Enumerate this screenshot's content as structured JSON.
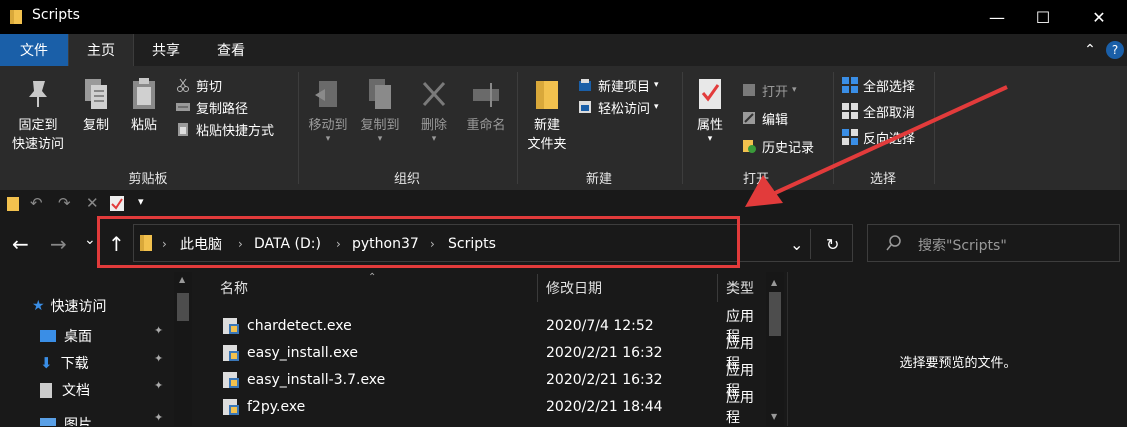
{
  "window": {
    "title": "Scripts",
    "min_glyph": "—",
    "max_glyph": "☐",
    "close_glyph": "✕"
  },
  "tabs": [
    {
      "label": "文件"
    },
    {
      "label": "主页"
    },
    {
      "label": "共享"
    },
    {
      "label": "查看"
    }
  ],
  "tab_right": {
    "collapse_glyph": "⌃",
    "help_glyph": "?"
  },
  "ribbon": {
    "clipboard": {
      "pin_line1": "固定到",
      "pin_line2": "快速访问",
      "copy": "复制",
      "paste": "粘贴",
      "cut": "剪切",
      "copy_path": "复制路径",
      "paste_shortcut": "粘贴快捷方式",
      "label": "剪贴板"
    },
    "organize": {
      "move_to": "移动到",
      "copy_to": "复制到",
      "delete": "删除",
      "rename": "重命名",
      "label": "组织"
    },
    "new": {
      "new_folder_line1": "新建",
      "new_folder_line2": "文件夹",
      "new_item": "新建项目",
      "easy_access": "轻松访问",
      "label": "新建"
    },
    "open": {
      "properties": "属性",
      "open": "打开",
      "edit": "编辑",
      "history": "历史记录",
      "label": "打开"
    },
    "select": {
      "select_all": "全部选择",
      "select_none": "全部取消",
      "invert": "反向选择",
      "label": "选择"
    }
  },
  "qat": {
    "dropdown_glyph": "▾"
  },
  "nav": {
    "back": "←",
    "forward": "→",
    "recent": "⌄",
    "up": "↑"
  },
  "address": {
    "crumbs": [
      "此电脑",
      "DATA (D:)",
      "python37",
      "Scripts"
    ],
    "separator": "›",
    "dropdown_glyph": "⌄",
    "refresh_glyph": "↻"
  },
  "search": {
    "placeholder": "搜索\"Scripts\""
  },
  "sidebar": {
    "items": [
      {
        "label": "快速访问"
      },
      {
        "label": "桌面"
      },
      {
        "label": "下载"
      },
      {
        "label": "文档"
      },
      {
        "label": "图片"
      }
    ],
    "pin_glyph": "📌"
  },
  "filelist": {
    "columns": {
      "name": "名称",
      "date": "修改日期",
      "type": "类型"
    },
    "rows": [
      {
        "name": "chardetect.exe",
        "date": "2020/7/4 12:52",
        "type": "应用程"
      },
      {
        "name": "easy_install.exe",
        "date": "2020/2/21 16:32",
        "type": "应用程"
      },
      {
        "name": "easy_install-3.7.exe",
        "date": "2020/2/21 16:32",
        "type": "应用程"
      },
      {
        "name": "f2py.exe",
        "date": "2020/2/21 18:44",
        "type": "应用程"
      }
    ]
  },
  "preview": {
    "text": "选择要预览的文件。"
  },
  "colors": {
    "accent": "#1a5fa8",
    "annotation": "#e23b3b",
    "folder": "#f2c14e"
  }
}
